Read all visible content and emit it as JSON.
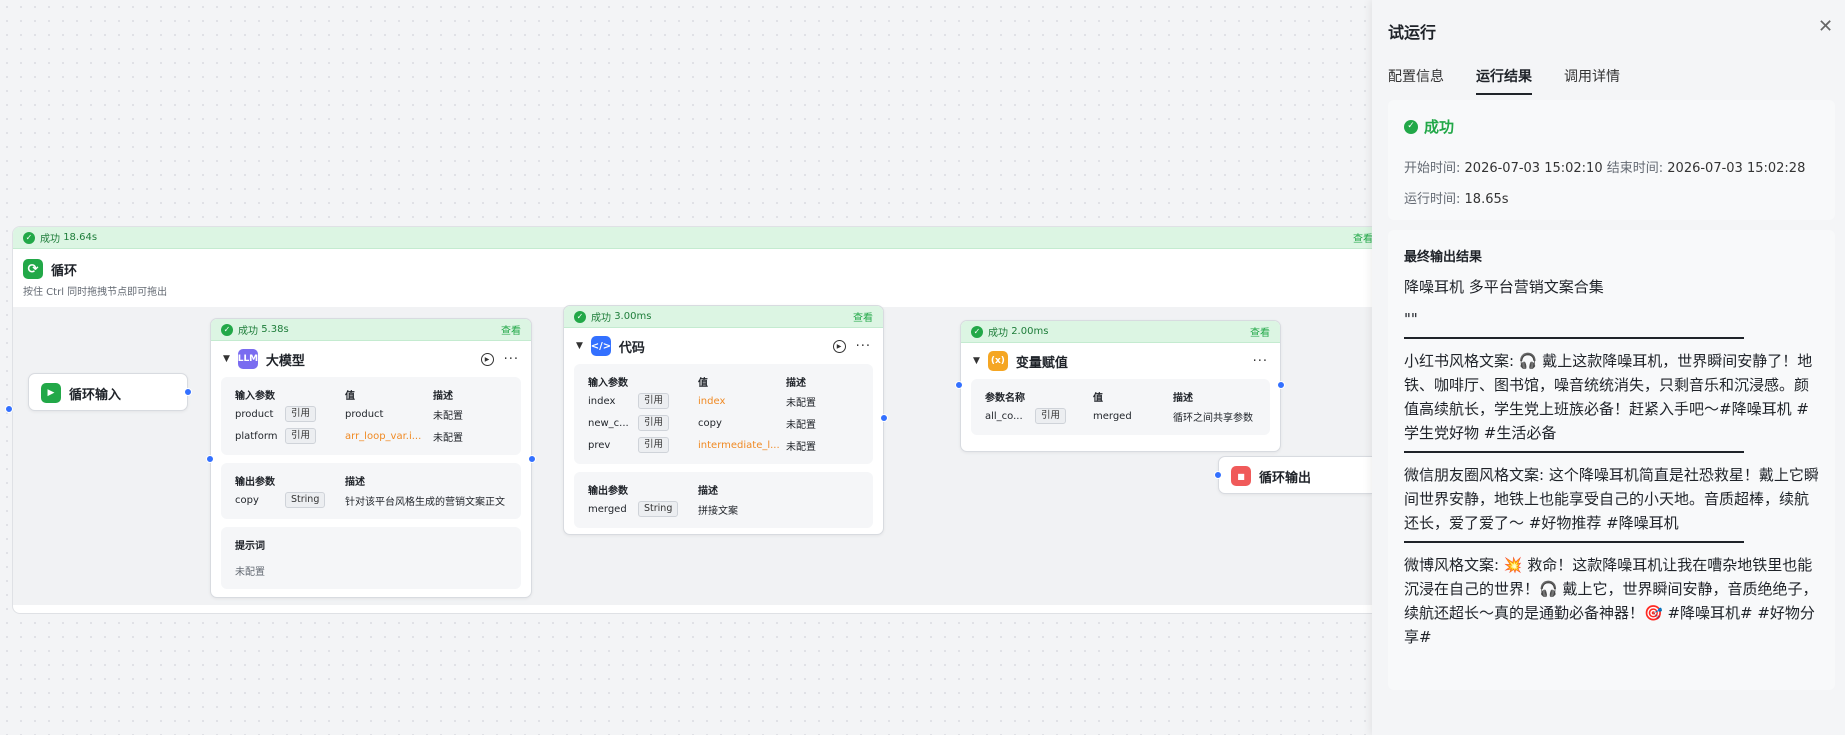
{
  "loop": {
    "status": "成功",
    "time": "18.64s",
    "title": "循环",
    "hint": "按住 Ctrl 同时拖拽节点即可拖出",
    "view": "查看"
  },
  "start_node": {
    "title": "循环输入"
  },
  "end_node": {
    "title": "循环输出"
  },
  "llm_node": {
    "status": "成功",
    "time": "5.38s",
    "view": "查看",
    "icon_text": "LLM",
    "title": "大模型",
    "input_header": [
      "输入参数",
      "值",
      "描述"
    ],
    "inputs": [
      {
        "name": "product",
        "tag": "引用",
        "value": "product",
        "desc": "未配置"
      },
      {
        "name": "platform",
        "tag": "引用",
        "value": "arr_loop_var.i...",
        "desc": "未配置"
      }
    ],
    "output_header": [
      "输出参数",
      "描述"
    ],
    "outputs": [
      {
        "name": "copy",
        "type": "String",
        "desc": "针对该平台风格生成的营销文案正文"
      }
    ],
    "prompt_label": "提示词",
    "prompt_value": "未配置"
  },
  "code_node": {
    "status": "成功",
    "time": "3.00ms",
    "view": "查看",
    "title": "代码",
    "input_header": [
      "输入参数",
      "值",
      "描述"
    ],
    "inputs": [
      {
        "name": "index",
        "tag": "引用",
        "value": "index",
        "desc": "未配置"
      },
      {
        "name": "new_c...",
        "tag": "引用",
        "value": "copy",
        "desc": "未配置"
      },
      {
        "name": "prev",
        "tag": "引用",
        "value": "intermediate_l...",
        "desc": "未配置"
      }
    ],
    "output_header": [
      "输出参数",
      "描述"
    ],
    "outputs": [
      {
        "name": "merged",
        "type": "String",
        "desc": "拼接文案"
      }
    ]
  },
  "var_node": {
    "status": "成功",
    "time": "2.00ms",
    "view": "查看",
    "icon_text": "(x)",
    "title": "变量赋值",
    "header": [
      "参数名称",
      "值",
      "描述"
    ],
    "rows": [
      {
        "name": "all_co...",
        "tag": "引用",
        "value": "merged",
        "desc": "循环之间共享参数"
      }
    ]
  },
  "panel": {
    "title": "试运行",
    "tabs": [
      "配置信息",
      "运行结果",
      "调用详情"
    ],
    "active_tab": 1,
    "status": "成功",
    "start_label": "开始时间:",
    "start_value": "2026-07-03 15:02:10",
    "end_label": "结束时间:",
    "end_value": "2026-07-03 15:02:28",
    "run_label": "运行时间:",
    "run_value": "18.65s",
    "output_title": "最终输出结果",
    "output_heading": "降噪耳机 多平台营销文案合集",
    "output_quote": "\"\"",
    "paragraphs": [
      "小红书风格文案: 🎧 戴上这款降噪耳机，世界瞬间安静了！地铁、咖啡厅、图书馆，噪音统统消失，只剩音乐和沉浸感。颜值高续航长，学生党上班族必备！赶紧入手吧〜#降噪耳机 #学生党好物 #生活必备",
      "微信朋友圈风格文案: 这个降噪耳机简直是社恐救星！戴上它瞬间世界安静，地铁上也能享受自己的小天地。音质超棒，续航还长，爱了爱了〜 #好物推荐 #降噪耳机",
      "微博风格文案: 💥 救命！这款降噪耳机让我在嘈杂地铁里也能沉浸在自己的世界！🎧 戴上它，世界瞬间安静，音质绝绝子，续航还超长〜真的是通勤必备神器！🎯 #降噪耳机# #好物分享#"
    ]
  },
  "colors": {
    "success": "#22a848",
    "accent": "#3370ff",
    "orange": "#f08a24",
    "var_icon": "#f5a623",
    "llm_icon": "#7a6cf0",
    "code_icon": "#3370ff",
    "end_icon": "#f05a5a"
  }
}
